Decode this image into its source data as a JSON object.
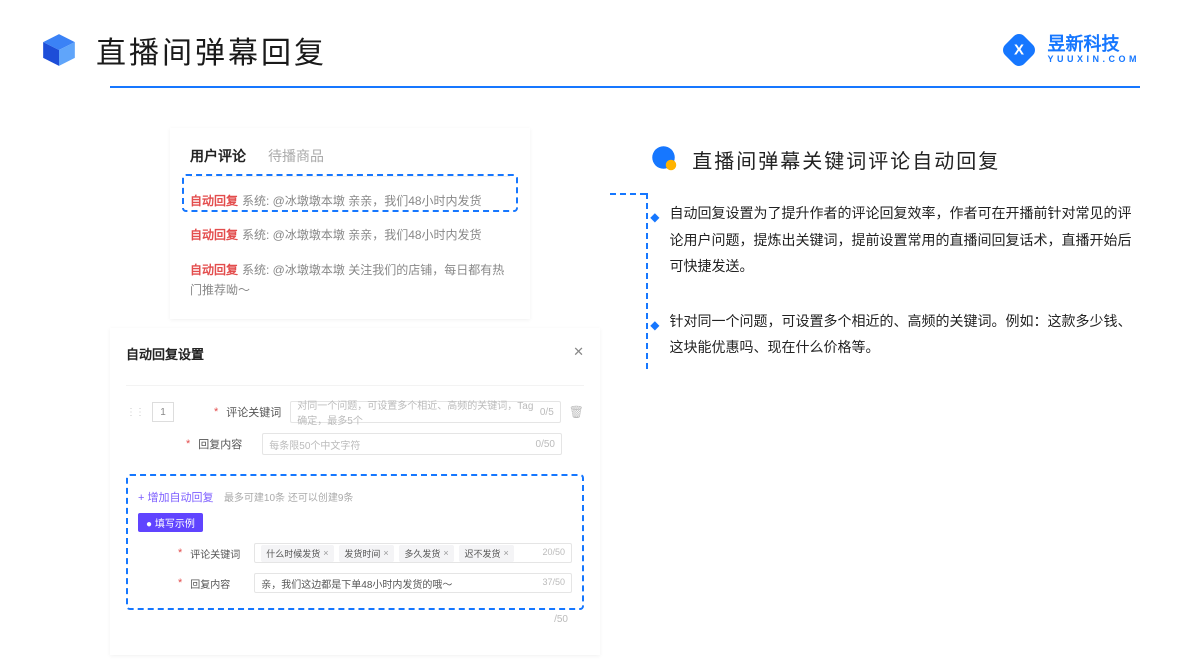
{
  "header": {
    "title": "直播间弹幕回复"
  },
  "brand": {
    "name": "昱新科技",
    "sub": "YUUXIN.COM"
  },
  "commentsCard": {
    "tabs": {
      "active": "用户评论",
      "inactive": "待播商品"
    },
    "lines": [
      {
        "tag": "自动回复",
        "text": "系统: @冰墩墩本墩 亲亲，我们48小时内发货"
      },
      {
        "tag": "自动回复",
        "text": "系统: @冰墩墩本墩 亲亲，我们48小时内发货"
      },
      {
        "tag": "自动回复",
        "text": "系统: @冰墩墩本墩 关注我们的店铺，每日都有热门推荐呦～"
      }
    ]
  },
  "settings": {
    "title": "自动回复设置",
    "rowNum": "1",
    "keywordLabel": "评论关键词",
    "keywordPlaceholder": "对同一个问题，可设置多个相近、高频的关键词，Tag确定，最多5个",
    "keywordCount": "0/5",
    "replyLabel": "回复内容",
    "replyPlaceholder": "每条限50个中文字符",
    "replyCount": "0/50",
    "addLink": "+ 增加自动回复",
    "addHint": "最多可建10条 还可以创建9条",
    "exampleBadge": "● 填写示例",
    "exKeywordLabel": "评论关键词",
    "exTags": [
      "什么时候发货",
      "发货时间",
      "多久发货",
      "迟不发货"
    ],
    "exTagCount": "20/50",
    "exReplyLabel": "回复内容",
    "exReplyValue": "亲，我们这边都是下单48小时内发货的哦～",
    "exReplyCount": "37/50",
    "bottomCount": "/50"
  },
  "right": {
    "subtitle": "直播间弹幕关键词评论自动回复",
    "bullets": [
      "自动回复设置为了提升作者的评论回复效率，作者可在开播前针对常见的评论用户问题，提炼出关键词，提前设置常用的直播间回复话术，直播开始后可快捷发送。",
      "针对同一个问题，可设置多个相近的、高频的关键词。例如：这款多少钱、这块能优惠吗、现在什么价格等。"
    ]
  }
}
